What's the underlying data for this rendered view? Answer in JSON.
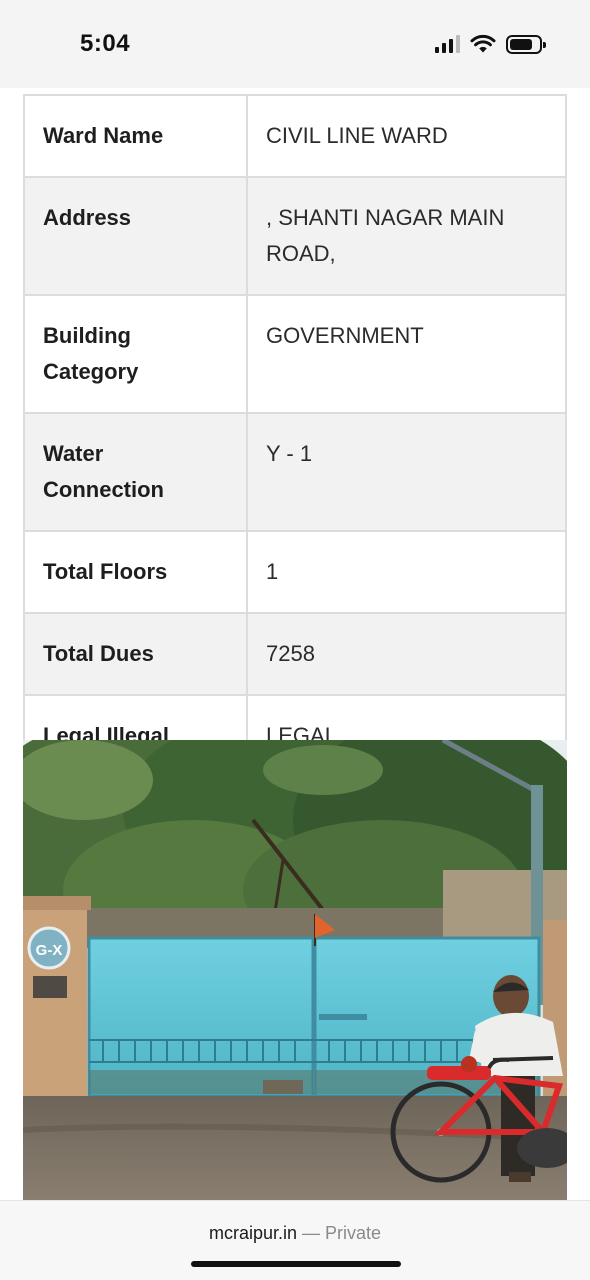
{
  "status_bar": {
    "time": "5:04",
    "icons": [
      "cellular-signal-icon",
      "wifi-icon",
      "battery-icon"
    ]
  },
  "property_table": [
    {
      "label": "Ward Name",
      "value": "CIVIL LINE WARD"
    },
    {
      "label": "Address",
      "value": ", SHANTI NAGAR MAIN ROAD,"
    },
    {
      "label": "Building Category",
      "value": "GOVERNMENT"
    },
    {
      "label": "Water Connection",
      "value": "Y - 1"
    },
    {
      "label": "Total Floors",
      "value": "1"
    },
    {
      "label": "Total Dues",
      "value": "7258"
    },
    {
      "label": "Legal Illegal",
      "value": "LEGAL"
    }
  ],
  "photo": {
    "gate_sign": "G-X"
  },
  "browser_bar": {
    "domain": "mcraipur.in",
    "separator": "—",
    "mode": "Private"
  },
  "colors": {
    "row_alt_background": "#f2f2f2",
    "table_border": "#dcdcdc",
    "gate_blue": "#5bc3d6",
    "bicycle_red": "#d92b2b"
  }
}
